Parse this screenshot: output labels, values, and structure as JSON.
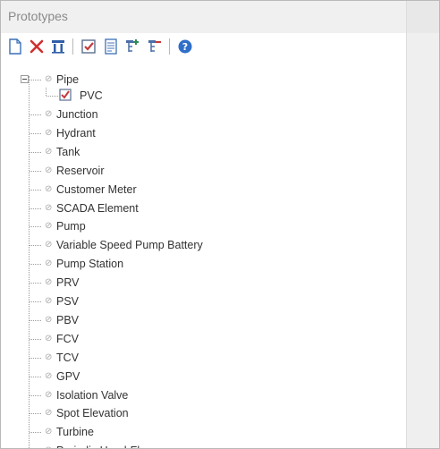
{
  "panel": {
    "title": "Prototypes"
  },
  "toolbar": {
    "buttons": [
      {
        "name": "new-button",
        "icon": "new-document-icon",
        "color": "#3b6fb6"
      },
      {
        "name": "delete-button",
        "icon": "delete-x-icon",
        "color": "#d03030"
      },
      {
        "name": "rename-button",
        "icon": "rename-icon",
        "color": "#2f5fa8"
      },
      {
        "name": "make-default-button",
        "icon": "checkbox-icon",
        "color": "#c43a3a"
      },
      {
        "name": "report-button",
        "icon": "report-icon",
        "color": "#3b6fb6"
      },
      {
        "name": "import-button",
        "icon": "import-tree-icon",
        "color": "#2e8b57"
      },
      {
        "name": "export-button",
        "icon": "export-tree-icon",
        "color": "#c43a3a"
      },
      {
        "name": "help-button",
        "icon": "help-icon",
        "color": "#2f6fc8"
      }
    ]
  },
  "tree": {
    "root_label": "Pipe",
    "child_label": "PVC",
    "items": [
      "Junction",
      "Hydrant",
      "Tank",
      "Reservoir",
      "Customer Meter",
      "SCADA Element",
      "Pump",
      "Variable Speed Pump Battery",
      "Pump Station",
      "PRV",
      "PSV",
      "PBV",
      "FCV",
      "TCV",
      "GPV",
      "Isolation Valve",
      "Spot Elevation",
      "Turbine",
      "Periodic Head-Flow"
    ]
  }
}
